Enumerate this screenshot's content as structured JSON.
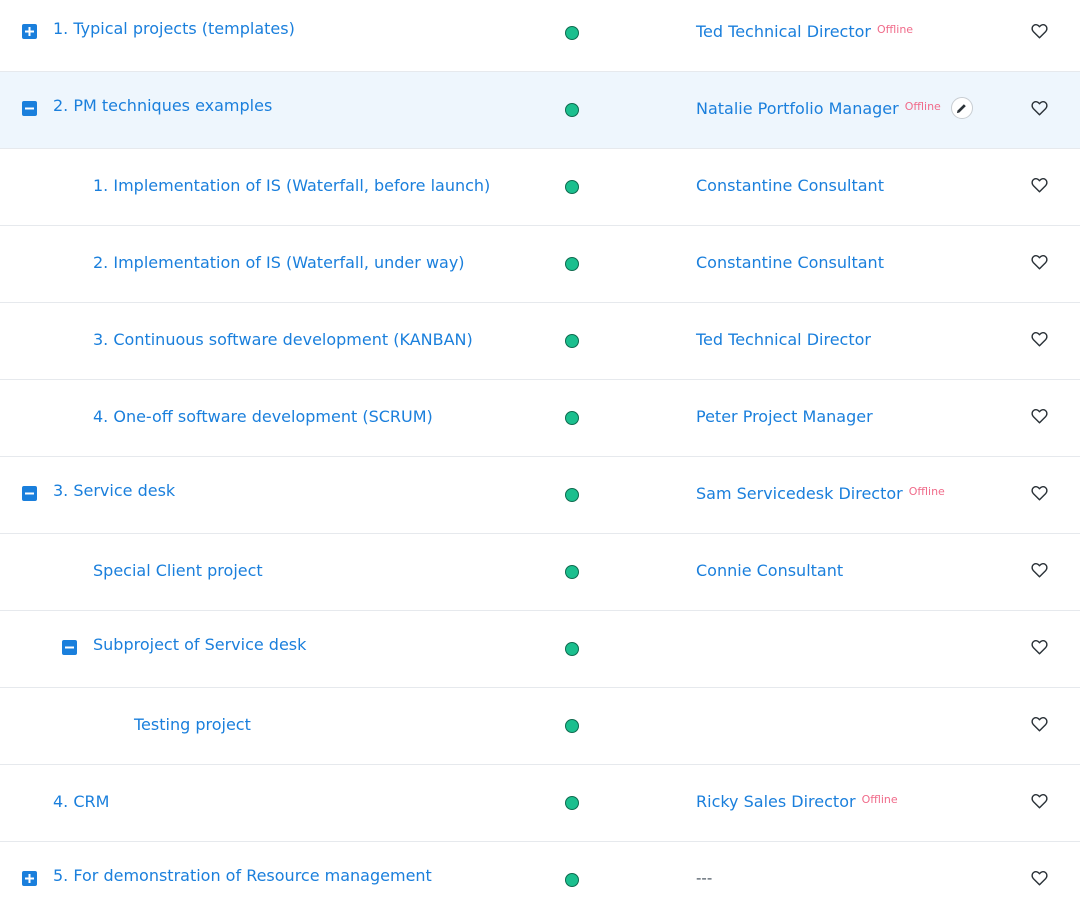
{
  "status_color": "#1bbf8e",
  "accent_color": "#1a7fdc",
  "offline_color": "#f06b8a",
  "rows": [
    {
      "name": "1. Typical projects (templates)",
      "toggle": "plus",
      "manager": "Ted Technical Director",
      "offline": "Offline"
    },
    {
      "name": "2. PM techniques examples",
      "toggle": "minus",
      "manager": "Natalie Portfolio Manager",
      "offline": "Offline",
      "selected": true,
      "edit_icon": "pencil-icon"
    },
    {
      "name": "1. Implementation of IS (Waterfall, before launch)",
      "manager": "Constantine Consultant"
    },
    {
      "name": "2. Implementation of IS (Waterfall, under way)",
      "manager": "Constantine Consultant"
    },
    {
      "name": "3. Continuous software development (KANBAN)",
      "manager": "Ted Technical Director"
    },
    {
      "name": "4. One-off software development (SCRUM)",
      "manager": "Peter Project Manager"
    },
    {
      "name": "3. Service desk",
      "toggle": "minus",
      "manager": "Sam Servicedesk Director",
      "offline": "Offline"
    },
    {
      "name": "Special Client project",
      "manager": "Connie Consultant"
    },
    {
      "name": "Subproject of Service desk",
      "toggle": "minus",
      "manager": ""
    },
    {
      "name": "Testing project",
      "manager": ""
    },
    {
      "name": "4. CRM",
      "manager": "Ricky Sales Director",
      "offline": "Offline"
    },
    {
      "name": "5. For demonstration of Resource management",
      "toggle": "plus",
      "manager": "---"
    }
  ],
  "icons": {
    "toggle_plus": "expand-plus-icon",
    "toggle_minus": "collapse-minus-icon",
    "status": "status-dot-icon",
    "favorite": "heart-outline-icon",
    "edit": "pencil-icon"
  }
}
